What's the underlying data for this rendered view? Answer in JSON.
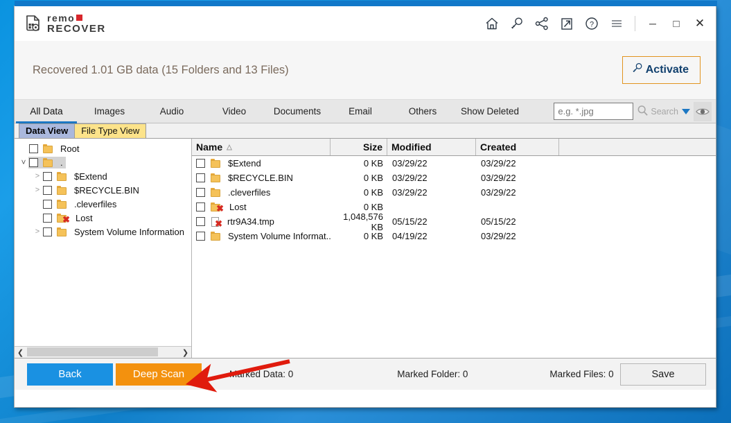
{
  "window": {
    "app_logo_line1": "remo",
    "app_logo_line2": "RECOVER",
    "titlebar_icons": [
      "home-icon",
      "key-icon",
      "share-icon",
      "external-link-icon",
      "help-icon",
      "menu-icon"
    ],
    "minimize": "─",
    "maximize": "□",
    "close": "✕"
  },
  "banner": {
    "summary": "Recovered 1.01 GB data (15 Folders and 13 Files)",
    "activate_label": "Activate"
  },
  "filter_tabs": [
    {
      "label": "All Data",
      "active": true
    },
    {
      "label": "Images",
      "active": false
    },
    {
      "label": "Audio",
      "active": false
    },
    {
      "label": "Video",
      "active": false
    },
    {
      "label": "Documents",
      "active": false
    },
    {
      "label": "Email",
      "active": false
    },
    {
      "label": "Others",
      "active": false
    },
    {
      "label": "Show Deleted",
      "active": false
    }
  ],
  "search": {
    "value": "",
    "placeholder": "e.g. *.jpg",
    "button_label": "Search",
    "dropdown": "chevron-down-icon",
    "preview_toggle": "eye-icon"
  },
  "view_tabs": {
    "data_view": "Data View",
    "file_type_view": "File Type View",
    "active": "Data View"
  },
  "tree": [
    {
      "label": "Root",
      "depth": 0,
      "chevron": "none",
      "icon": "folder",
      "deleted": false,
      "selected": false
    },
    {
      "label": ".",
      "depth": 1,
      "chevron": "down",
      "icon": "folder",
      "deleted": false,
      "selected": true
    },
    {
      "label": "$Extend",
      "depth": 2,
      "chevron": "right",
      "icon": "folder",
      "deleted": false,
      "selected": false
    },
    {
      "label": "$RECYCLE.BIN",
      "depth": 2,
      "chevron": "right",
      "icon": "folder",
      "deleted": false,
      "selected": false
    },
    {
      "label": ".cleverfiles",
      "depth": 2,
      "chevron": "none",
      "icon": "folder",
      "deleted": false,
      "selected": false
    },
    {
      "label": "Lost",
      "depth": 2,
      "chevron": "none",
      "icon": "folder",
      "deleted": true,
      "selected": false
    },
    {
      "label": "System Volume Information",
      "depth": 2,
      "chevron": "right",
      "icon": "folder",
      "deleted": false,
      "selected": false
    }
  ],
  "file_list": {
    "columns": [
      "Name",
      "Size",
      "Modified",
      "Created",
      ""
    ],
    "sort_column": "Name",
    "sort_direction": "ascending",
    "rows": [
      {
        "name": "$Extend",
        "size": "0 KB",
        "modified": "03/29/22",
        "created": "03/29/22",
        "icon": "folder",
        "deleted": false
      },
      {
        "name": "$RECYCLE.BIN",
        "size": "0 KB",
        "modified": "03/29/22",
        "created": "03/29/22",
        "icon": "folder",
        "deleted": false
      },
      {
        "name": ".cleverfiles",
        "size": "0 KB",
        "modified": "03/29/22",
        "created": "03/29/22",
        "icon": "folder",
        "deleted": false
      },
      {
        "name": "Lost",
        "size": "0 KB",
        "modified": "",
        "created": "",
        "icon": "folder",
        "deleted": true
      },
      {
        "name": "rtr9A34.tmp",
        "size": "1,048,576 KB",
        "modified": "05/15/22",
        "created": "05/15/22",
        "icon": "file",
        "deleted": true
      },
      {
        "name": "System Volume Informat...",
        "size": "0 KB",
        "modified": "04/19/22",
        "created": "03/29/22",
        "icon": "folder",
        "deleted": false
      }
    ]
  },
  "footer": {
    "back_label": "Back",
    "deep_scan_label": "Deep Scan",
    "marked_data": "Marked Data: 0",
    "marked_folder": "Marked Folder:  0",
    "marked_files": "Marked Files: 0",
    "save_label": "Save"
  },
  "colors": {
    "accent_blue": "#1a91e2",
    "deep_scan_orange": "#f3910e",
    "activate_border": "#e2941f",
    "activate_text": "#11406e",
    "tab_underline": "#1c77c3",
    "logo_red": "#d8272c",
    "data_view_tab": "#aab8dd",
    "file_type_view_tab": "#fce38a",
    "deleted_marker": "#d62a22",
    "annotation_arrow": "#e01b0d",
    "banner_text": "#7a6a5c"
  },
  "annotation": {
    "type": "arrow",
    "target": "deep-scan-button",
    "color": "#e01b0d"
  }
}
